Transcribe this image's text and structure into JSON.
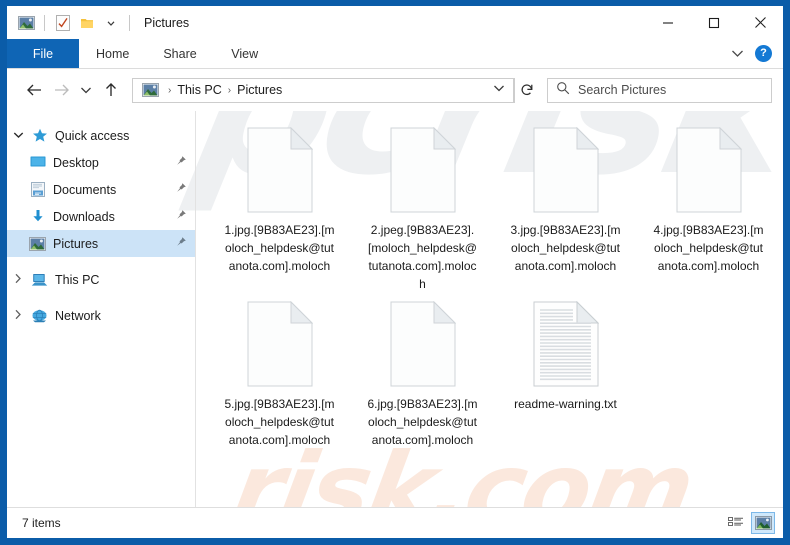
{
  "window": {
    "title": "Pictures",
    "quick_access_toolbar": [
      {
        "name": "pictures-folder-icon",
        "label": "Pictures"
      },
      {
        "name": "properties-icon",
        "label": "Properties"
      },
      {
        "name": "new-folder-icon",
        "label": "New folder"
      },
      {
        "name": "customize-dropdown-icon",
        "label": "Customize Quick Access Toolbar"
      }
    ],
    "controls": {
      "minimize": "—",
      "maximize": "☐",
      "close": "✕"
    }
  },
  "ribbon": {
    "tabs": [
      {
        "label": "File",
        "selected": true
      },
      {
        "label": "Home",
        "selected": false
      },
      {
        "label": "Share",
        "selected": false
      },
      {
        "label": "View",
        "selected": false
      }
    ],
    "collapse_glyph": "∨",
    "help_glyph": "?"
  },
  "navbar": {
    "back_glyph": "←",
    "forward_glyph": "→",
    "recent_glyph": "∨",
    "up_glyph": "↑",
    "breadcrumb": [
      "This PC",
      "Pictures"
    ],
    "breadcrumb_separator": "›",
    "address_dropdown_glyph": "∨",
    "refresh_glyph": "↻",
    "search_placeholder": "Search Pictures",
    "search_value": ""
  },
  "sidebar": {
    "items": [
      {
        "label": "Quick access",
        "icon": "star-icon",
        "level": 0,
        "expanded": true,
        "selected": false,
        "pinned": false
      },
      {
        "label": "Desktop",
        "icon": "desktop-icon",
        "level": 1,
        "expanded": null,
        "selected": false,
        "pinned": true
      },
      {
        "label": "Documents",
        "icon": "documents-icon",
        "level": 1,
        "expanded": null,
        "selected": false,
        "pinned": true
      },
      {
        "label": "Downloads",
        "icon": "downloads-icon",
        "level": 1,
        "expanded": null,
        "selected": false,
        "pinned": true
      },
      {
        "label": "Pictures",
        "icon": "pictures-icon",
        "level": 1,
        "expanded": null,
        "selected": true,
        "pinned": true
      },
      {
        "label": "This PC",
        "icon": "this-pc-icon",
        "level": 0,
        "expanded": false,
        "selected": false,
        "pinned": false
      },
      {
        "label": "Network",
        "icon": "network-icon",
        "level": 0,
        "expanded": false,
        "selected": false,
        "pinned": false
      }
    ],
    "pin_glyph": "📌",
    "chevron_collapsed": "›",
    "chevron_expanded": "ⱟ"
  },
  "files": [
    {
      "name": "1.jpg.[9B83AE23].[moloch_helpdesk@tutanota.com].moloch",
      "icon": "blank-file-icon"
    },
    {
      "name": "2.jpeg.[9B83AE23].[moloch_helpdesk@tutanota.com].moloch",
      "icon": "blank-file-icon"
    },
    {
      "name": "3.jpg.[9B83AE23].[moloch_helpdesk@tutanota.com].moloch",
      "icon": "blank-file-icon"
    },
    {
      "name": "4.jpg.[9B83AE23].[moloch_helpdesk@tutanota.com].moloch",
      "icon": "blank-file-icon"
    },
    {
      "name": "5.jpg.[9B83AE23].[moloch_helpdesk@tutanota.com].moloch",
      "icon": "blank-file-icon"
    },
    {
      "name": "6.jpg.[9B83AE23].[moloch_helpdesk@tutanota.com].moloch",
      "icon": "blank-file-icon"
    },
    {
      "name": "readme-warning.txt",
      "icon": "text-file-icon"
    }
  ],
  "status": {
    "item_count": "7 items",
    "views": [
      {
        "name": "details-view-button",
        "active": false
      },
      {
        "name": "large-icons-view-button",
        "active": true
      }
    ]
  },
  "watermarks": {
    "top": "pcrisk",
    "bottom": "risk.com"
  },
  "colors": {
    "window_frame": "#0b5ca8",
    "file_tab": "#0f65b5",
    "selection": "#cce3f7",
    "help_button": "#1479d4",
    "accent_blue": "#1479d4",
    "watermark_top": "#eef0f2",
    "watermark_bottom": "#fbe8dd"
  }
}
